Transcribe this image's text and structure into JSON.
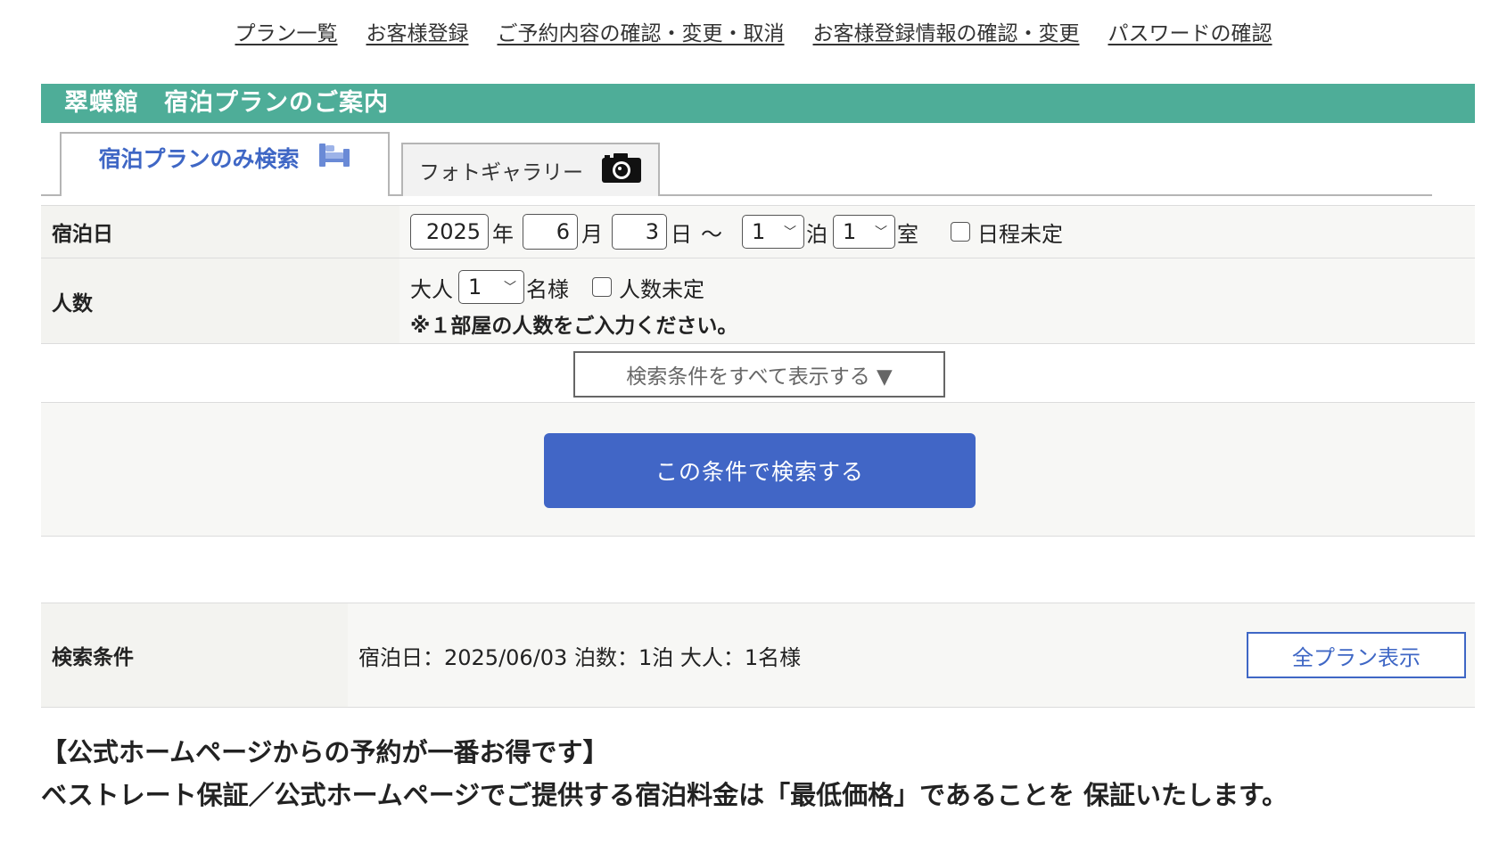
{
  "top_nav": [
    {
      "label": "プラン一覧"
    },
    {
      "label": "お客様登録"
    },
    {
      "label": "ご予約内容の確認・変更・取消"
    },
    {
      "label": "お客様登録情報の確認・変更"
    },
    {
      "label": "パスワードの確認"
    }
  ],
  "title_bar": "翠蝶館　宿泊プランのご案内",
  "tabs": {
    "active": {
      "label": "宿泊プランのみ検索",
      "icon": "bed-icon"
    },
    "inactive": {
      "label": "フォトギャラリー",
      "icon": "camera-icon"
    }
  },
  "form": {
    "date_row": {
      "label": "宿泊日",
      "year": "2025",
      "year_unit": "年",
      "month": "6",
      "month_unit": "月",
      "day": "3",
      "day_unit": "日",
      "tilde": "〜",
      "nights": "1",
      "nights_unit": "泊",
      "rooms": "1",
      "rooms_unit": "室",
      "undecided_label": "日程未定"
    },
    "people_row": {
      "label": "人数",
      "adults_prefix": "大人",
      "adults": "1",
      "adults_unit": "名様",
      "undecided_label": "人数未定",
      "note": "※１部屋の人数をご入力ください。"
    },
    "show_all_conditions": "検索条件をすべて表示する ▼",
    "search_button": "この条件で検索する"
  },
  "summary": {
    "label": "検索条件",
    "text": "宿泊日：2025/06/03 泊数：1泊 大人：1名様",
    "all_plans_button": "全プラン表示"
  },
  "promo": {
    "line1": "【公式ホームページからの予約が一番お得です】",
    "line2": "ベストレート保証／公式ホームページでご提供する宿泊料金は「最低価格」であることを 保証いたします。"
  },
  "colors": {
    "title_bar_bg": "#4ead98",
    "accent_blue": "#3f67c5",
    "search_button_bg": "#4166c6"
  }
}
